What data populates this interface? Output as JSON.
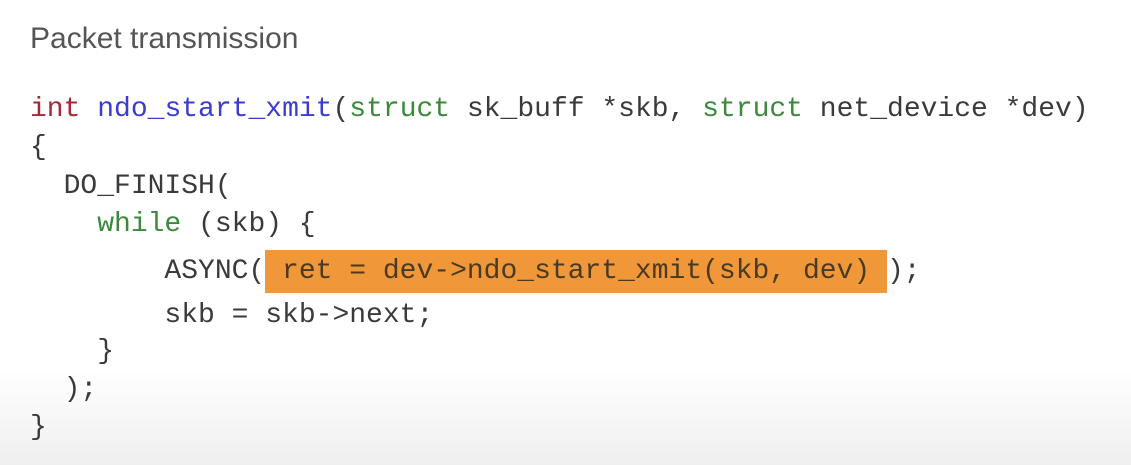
{
  "slide": {
    "title": "Packet transmission",
    "highlight_color": "#f0973a",
    "code": {
      "l1_type": "int",
      "l1_fn": "ndo_start_xmit",
      "l1_open": "(",
      "l1_struct1": "struct",
      "l1_arg1": " sk_buff *skb, ",
      "l1_struct2": "struct",
      "l1_arg2": " net_device *dev)",
      "l2": "{",
      "l3": "  DO_FINISH(",
      "l4_indent": "    ",
      "l4_kw": "while",
      "l4_rest": " (skb) {",
      "l5_pre": "        ASYNC(",
      "l5_hl": " ret = dev->ndo_start_xmit(skb, dev) ",
      "l5_post": ");",
      "l6": "        skb = skb->next;",
      "l7": "    }",
      "l8": "  );",
      "l9": "}"
    }
  }
}
